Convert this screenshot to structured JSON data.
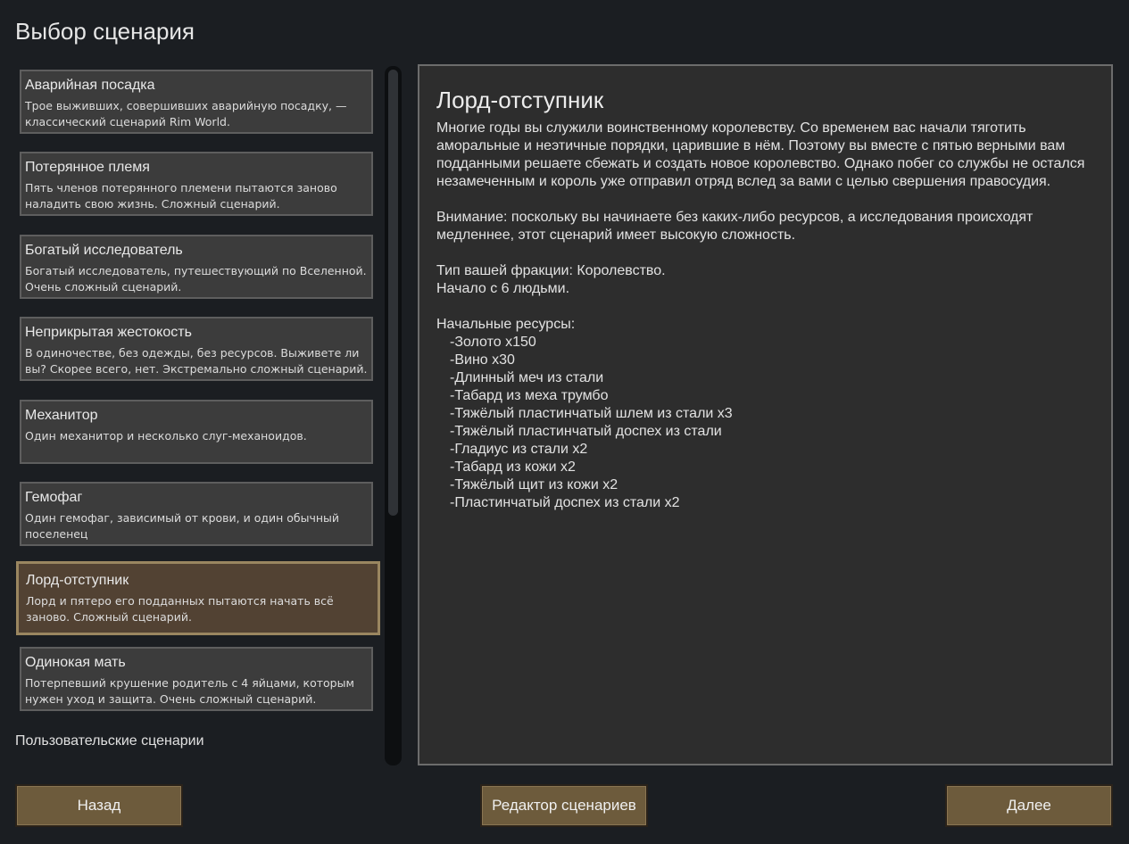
{
  "page_title": "Выбор сценария",
  "scenarios": [
    {
      "title": "Аварийная посадка",
      "desc": "Трое выживших, совершивших аварийную посадку, — классический сценарий Rim World."
    },
    {
      "title": "Потерянное племя",
      "desc": "Пять членов потерянного племени пытаются заново наладить свою жизнь. Сложный сценарий."
    },
    {
      "title": "Богатый исследователь",
      "desc": "Богатый исследователь, путешествующий по Вселенной. Очень сложный сценарий."
    },
    {
      "title": "Неприкрытая жестокость",
      "desc": "В одиночестве, без одежды, без ресурсов. Выживете ли вы? Скорее всего, нет. Экстремально сложный сценарий."
    },
    {
      "title": "Механитор",
      "desc": "Один механитор и несколько слуг-механоидов."
    },
    {
      "title": "Гемофаг",
      "desc": "Один гемофаг, зависимый от крови, и один обычный поселенец"
    },
    {
      "title": "Лорд-отступник",
      "desc": "Лорд и пятеро его подданных пытаются начать всё заново. Сложный сценарий.",
      "selected": true
    },
    {
      "title": "Одинокая мать",
      "desc": "Потерпевший крушение родитель с 4 яйцами, которым нужен уход и защита. Очень сложный сценарий."
    }
  ],
  "custom_header": "Пользовательские сценарии",
  "custom_cut_text": "· · ·",
  "detail": {
    "title": "Лорд-отступник",
    "intro": "Многие годы вы служили воинственному королевству. Со временем вас начали тяготить аморальные и неэтичные порядки, царившие в нём. Поэтому вы вместе с пятью верными вам подданными решаете сбежать и создать новое королевство. Однако побег со службы не остался незамеченным и король уже отправил отряд вслед за вами с целью свершения правосудия.",
    "warning": "Внимание: поскольку вы начинаете без каких-либо ресурсов, а исследования происходят медленнее, этот сценарий имеет высокую сложность.",
    "faction": "Тип вашей фракции: Королевство.",
    "start": "Начало с 6 людьми.",
    "resources_header": "Начальные ресурсы:",
    "resources": [
      "-Золото x150",
      "-Вино x30",
      "-Длинный меч из стали",
      "-Табард из меха трумбо",
      "-Тяжёлый пластинчатый шлем из стали x3",
      "-Тяжёлый пластинчатый доспех из стали",
      "-Гладиус из стали x2",
      "-Табард из кожи x2",
      "-Тяжёлый щит из кожи x2",
      "-Пластинчатый доспех из стали x2"
    ]
  },
  "buttons": {
    "back": "Назад",
    "editor": "Редактор сценариев",
    "next": "Далее"
  }
}
